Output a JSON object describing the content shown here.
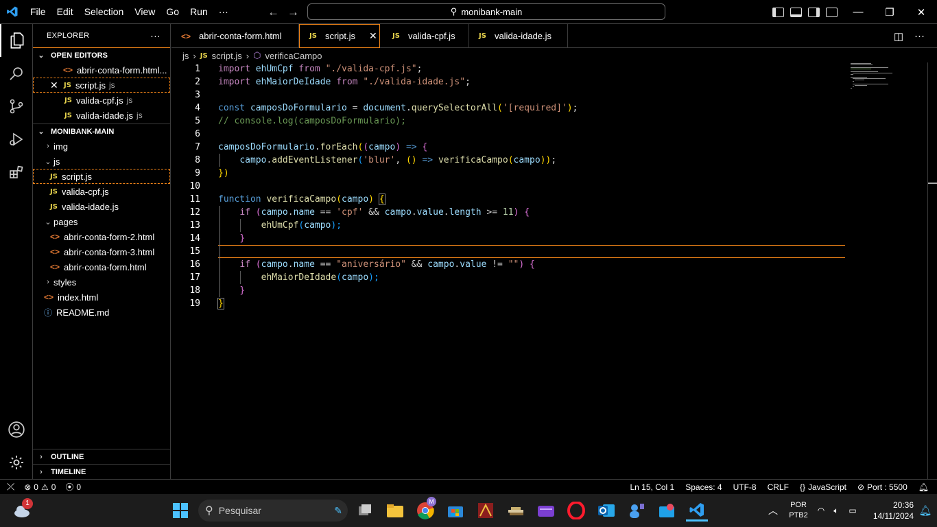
{
  "menu": {
    "file": "File",
    "edit": "Edit",
    "selection": "Selection",
    "view": "View",
    "go": "Go",
    "run": "Run",
    "more": "···"
  },
  "search": {
    "text": "monibank-main"
  },
  "explorer": {
    "title": "EXPLORER",
    "more": "···"
  },
  "open_editors": {
    "title": "OPEN EDITORS",
    "items": [
      {
        "name": "abrir-conta-form.html...",
        "type": "html"
      },
      {
        "name": "script.js",
        "suffix": "js",
        "type": "js"
      },
      {
        "name": "valida-cpf.js",
        "suffix": "js",
        "type": "js"
      },
      {
        "name": "valida-idade.js",
        "suffix": "js",
        "type": "js"
      }
    ]
  },
  "workspace": {
    "title": "MONIBANK-MAIN",
    "items": [
      {
        "name": "img"
      },
      {
        "name": "js"
      },
      {
        "name": "script.js"
      },
      {
        "name": "valida-cpf.js"
      },
      {
        "name": "valida-idade.js"
      },
      {
        "name": "pages"
      },
      {
        "name": "abrir-conta-form-2.html"
      },
      {
        "name": "abrir-conta-form-3.html"
      },
      {
        "name": "abrir-conta-form.html"
      },
      {
        "name": "styles"
      },
      {
        "name": "index.html"
      },
      {
        "name": "README.md"
      }
    ]
  },
  "outline": "OUTLINE",
  "timeline": "TIMELINE",
  "tabs": [
    {
      "label": "abrir-conta-form.html"
    },
    {
      "label": "script.js"
    },
    {
      "label": "valida-cpf.js"
    },
    {
      "label": "valida-idade.js"
    }
  ],
  "breadcrumb": {
    "folder": "js",
    "file": "script.js",
    "symbol": "verificaCampo"
  },
  "line_numbers": [
    "1",
    "2",
    "3",
    "4",
    "5",
    "6",
    "7",
    "8",
    "9",
    "10",
    "11",
    "12",
    "13",
    "14",
    "15",
    "16",
    "17",
    "18",
    "19"
  ],
  "code": {
    "l1": [
      "import",
      " ",
      "ehUmCpf",
      " ",
      "from",
      " ",
      "\"./valida-cpf.js\"",
      ";"
    ],
    "l2": [
      "import",
      " ",
      "ehMaiorDeIdade",
      " ",
      "from",
      " ",
      "\"./valida-idade.js\"",
      ";"
    ],
    "l4": [
      "const",
      " ",
      "camposDoFormulario",
      " = ",
      "document",
      ".",
      "querySelectorAll",
      "(",
      "'[required]'",
      ")",
      ";"
    ],
    "l5": "// console.log(camposDoFormulario);",
    "l7": [
      "camposDoFormulario",
      ".",
      "forEach",
      "(",
      "(",
      "campo",
      ") ",
      "=>",
      " {"
    ],
    "l8": [
      "    ",
      "campo",
      ".",
      "addEventListener",
      "(",
      "'blur'",
      ", ",
      "()",
      " ",
      "=>",
      " ",
      "verificaCampo",
      "(",
      "campo",
      "))",
      ";"
    ],
    "l9": [
      "})"
    ],
    "l11": [
      "function",
      " ",
      "verificaCampo",
      "(",
      "campo",
      ") ",
      "{"
    ],
    "l12": [
      "    ",
      "if",
      " (",
      "campo",
      ".",
      "name",
      " == ",
      "'cpf'",
      " && ",
      "campo",
      ".",
      "value",
      ".",
      "length",
      " >= ",
      "11",
      ") {"
    ],
    "l13": [
      "        ",
      "ehUmCpf",
      "(",
      "campo",
      ");"
    ],
    "l14": [
      "    ",
      "}"
    ],
    "l16": [
      "    ",
      "if",
      " (",
      "campo",
      ".",
      "name",
      " == ",
      "\"aniversário\"",
      " && ",
      "campo",
      ".",
      "value",
      " != ",
      "\"\"",
      ") {"
    ],
    "l17": [
      "        ",
      "ehMaiorDeIdade",
      "(",
      "campo",
      ");"
    ],
    "l18": [
      "    ",
      "}"
    ],
    "l19": [
      "}"
    ]
  },
  "status": {
    "errors": "0",
    "warnings": "0",
    "ports": "0",
    "position": "Ln 15, Col 1",
    "spaces": "Spaces: 4",
    "encoding": "UTF-8",
    "eol": "CRLF",
    "language": "JavaScript",
    "port": "Port : 5500"
  },
  "taskbar": {
    "search_placeholder": "Pesquisar",
    "weather_badge": "1",
    "chrome_badge": "M"
  },
  "tray": {
    "lang1": "POR",
    "lang2": "PTB2",
    "time": "20:36",
    "date": "14/11/2024"
  }
}
